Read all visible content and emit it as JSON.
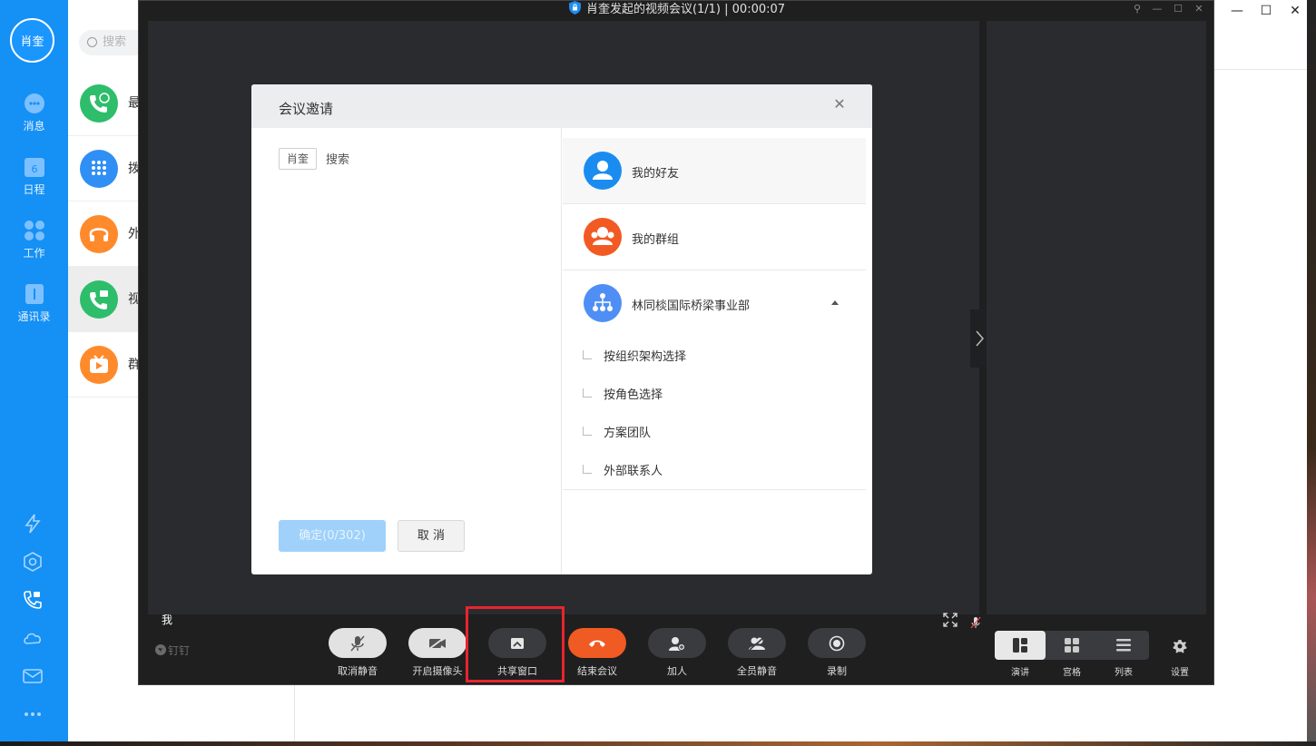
{
  "app": {
    "user_avatar_text": "肖奎",
    "nav": [
      {
        "label": "消息",
        "icon": "message-icon"
      },
      {
        "label": "日程",
        "icon": "calendar-icon",
        "badge": "6"
      },
      {
        "label": "工作",
        "icon": "apps-icon"
      },
      {
        "label": "通讯录",
        "icon": "contacts-icon"
      }
    ],
    "bottom_icons": [
      "lightning-icon",
      "cube-icon",
      "video-call-icon",
      "cloud-icon",
      "mail-icon",
      "more-icon"
    ],
    "search_placeholder": "搜索",
    "list": [
      {
        "label": "最",
        "icon": "recent-call-icon",
        "color": "#2ebd6b"
      },
      {
        "label": "拨",
        "icon": "dialpad-icon",
        "color": "#2f8ff5"
      },
      {
        "label": "外",
        "icon": "headset-icon",
        "color": "#ff8a2b"
      },
      {
        "label": "视",
        "icon": "video-phone-icon",
        "color": "#2ebd6b"
      },
      {
        "label": "群",
        "icon": "live-icon",
        "color": "#ff8a2b"
      }
    ]
  },
  "meeting": {
    "title": "肖奎发起的视频会议(1/1) | 00:00:07",
    "self_label": "我",
    "brand": "钉钉",
    "controls": [
      {
        "label": "取消静音",
        "icon": "mic-muted-icon",
        "style": "grey"
      },
      {
        "label": "开启摄像头",
        "icon": "camera-off-icon",
        "style": "grey"
      },
      {
        "label": "共享窗口",
        "icon": "share-screen-icon",
        "style": "dark"
      },
      {
        "label": "结束会议",
        "icon": "hangup-icon",
        "style": "red"
      },
      {
        "label": "加人",
        "icon": "add-person-icon",
        "style": "dark"
      },
      {
        "label": "全员静音",
        "icon": "mute-all-icon",
        "style": "dark"
      },
      {
        "label": "录制",
        "icon": "record-icon",
        "style": "dark"
      }
    ],
    "layouts": [
      {
        "label": "演讲",
        "icon": "speaker-layout-icon",
        "selected": true
      },
      {
        "label": "宫格",
        "icon": "grid-layout-icon",
        "selected": false
      },
      {
        "label": "列表",
        "icon": "list-layout-icon",
        "selected": false
      }
    ],
    "settings_label": "设置"
  },
  "dialog": {
    "title": "会议邀请",
    "chip": "肖奎",
    "search": "搜索",
    "confirm": "确定(0/302)",
    "cancel": "取 消",
    "categories": [
      {
        "label": "我的好友",
        "icon": "friend-icon",
        "color": "#1a8cf0"
      },
      {
        "label": "我的群组",
        "icon": "group-icon",
        "color": "#f25a23"
      },
      {
        "label": "林同棪国际桥梁事业部",
        "icon": "org-icon",
        "color": "#4f8ff5"
      }
    ],
    "sub_items": [
      "按组织架构选择",
      "按角色选择",
      "方案团队",
      "外部联系人"
    ]
  }
}
